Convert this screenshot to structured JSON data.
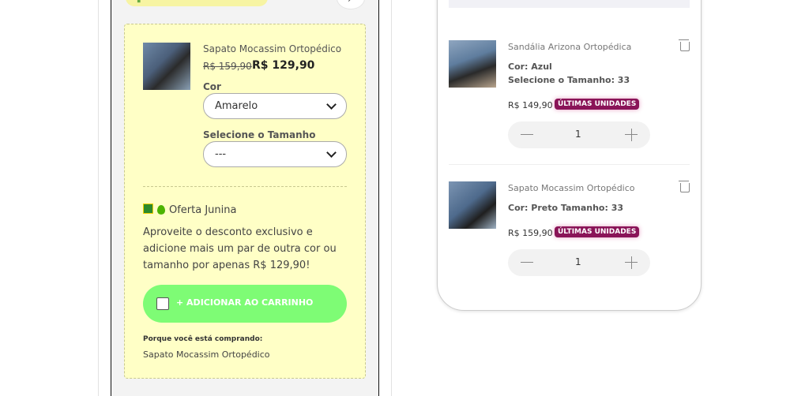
{
  "offer": {
    "product_name": "Sapato Mocassim Ortopédico",
    "old_price": "R$ 159,90",
    "new_price": "R$ 129,90",
    "color_label": "Cor",
    "color_value": "Amarelo",
    "size_label": "Selecione o Tamanho",
    "size_value": "---",
    "title": "Oferta Junina",
    "description": "Aproveite o desconto exclusivo e adicione mais um par de outra cor ou tamanho por apenas R$ 129,90!",
    "add_button_label": "+ ADICIONAR AO CARRINHO",
    "why_label": "Porque você está comprando:",
    "why_product": "Sapato Mocassim Ortopédico"
  },
  "cart": {
    "items": [
      {
        "name": "Sandália Arizona Ortopédica",
        "attr1": "Cor: Azul",
        "attr2": "Selecione o Tamanho: 33",
        "price": "R$ 149,90",
        "badge": "ÚLTIMAS UNIDADES",
        "qty": "1"
      },
      {
        "name": "Sapato Mocassim Ortopédico",
        "attr1": "Cor: Preto  Tamanho: 33",
        "price": "R$ 159,90",
        "badge": "ÚLTIMAS UNIDADES",
        "qty": "1"
      }
    ]
  },
  "colors": {
    "offer_background": "#ffffc6",
    "add_button": "#7efc75",
    "badge": "#8a1458"
  }
}
